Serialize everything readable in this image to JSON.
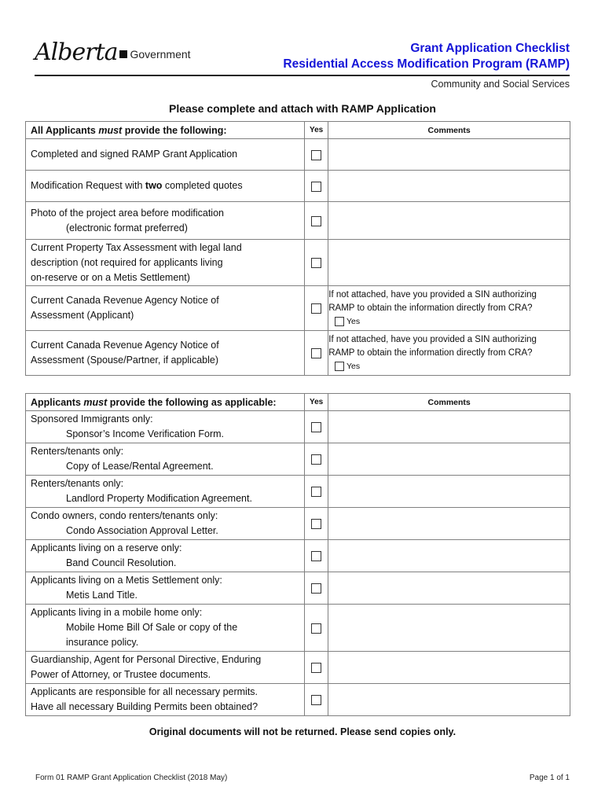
{
  "header": {
    "logo_script": "Alberta",
    "logo_gov": "Government",
    "title_line1": "Grant Application Checklist",
    "title_line2": "Residential Access Modification Program (RAMP)",
    "department": "Community and Social Services",
    "title_color": "#1414d8"
  },
  "section_title": "Please complete and attach with RAMP Application",
  "table1": {
    "header_prefix": "All Applicants ",
    "header_emph": "must",
    "header_suffix": " provide the following:",
    "yes_label": "Yes",
    "comments_label": "Comments",
    "rows": [
      {
        "line1": "Completed and signed RAMP Grant Application",
        "checked": false
      },
      {
        "line1_pre": "Modification Request with ",
        "line1_bold": "two",
        "line1_post": " completed quotes",
        "checked": false
      },
      {
        "line1": "Photo of the project area before modification",
        "line2": "(electronic format preferred)",
        "checked": false
      },
      {
        "line1": "Current Property Tax Assessment with legal land",
        "line2": "description (not required for applicants living",
        "line3": "on-reserve or on a Metis Settlement)",
        "checked": false
      },
      {
        "line1": "Current Canada Revenue Agency Notice of",
        "line2": "Assessment (Applicant)",
        "checked": false,
        "comment_line1": "If not attached, have you provided a SIN authorizing",
        "comment_line2": "RAMP to obtain the information directly from CRA?",
        "comment_yes": "Yes",
        "comment_checked": false
      },
      {
        "line1": "Current Canada Revenue Agency Notice of",
        "line2": "Assessment (Spouse/Partner, if applicable)",
        "checked": false,
        "comment_line1": "If not attached, have you provided a SIN authorizing",
        "comment_line2": "RAMP to obtain the information directly from CRA?",
        "comment_yes": "Yes",
        "comment_checked": false
      }
    ]
  },
  "table2": {
    "header_prefix": "Applicants ",
    "header_emph": "must",
    "header_suffix": " provide the following as applicable:",
    "yes_label": "Yes",
    "comments_label": "Comments",
    "rows": [
      {
        "line1": "Sponsored Immigrants only:",
        "line2": "Sponsor’s Income Verification Form.",
        "checked": false
      },
      {
        "line1": "Renters/tenants only:",
        "line2": "Copy of Lease/Rental Agreement.",
        "checked": false
      },
      {
        "line1": "Renters/tenants only:",
        "line2": "Landlord Property Modification Agreement.",
        "checked": false
      },
      {
        "line1": "Condo owners, condo renters/tenants only:",
        "line2": "Condo Association Approval Letter.",
        "checked": false
      },
      {
        "line1": "Applicants living on a reserve only:",
        "line2": "Band Council Resolution.",
        "checked": false
      },
      {
        "line1": "Applicants living on a Metis Settlement only:",
        "line2": "Metis Land Title.",
        "checked": false
      },
      {
        "line1": "Applicants living in a mobile home only:",
        "line2": "Mobile Home Bill Of Sale or copy of the",
        "line3": "insurance policy.",
        "checked": false
      },
      {
        "line1": "Guardianship, Agent for Personal Directive, Enduring",
        "line2": "Power of Attorney, or Trustee documents.",
        "checked": false
      },
      {
        "line1": "Applicants are responsible for all necessary permits.",
        "line2": "Have all necessary Building Permits been obtained?",
        "checked": false
      }
    ]
  },
  "footer": {
    "note": "Original documents will not be returned. Please send copies only.",
    "form_id": "Form 01 RAMP Grant Application Checklist   (2018 May)",
    "page": "Page 1 of 1"
  }
}
